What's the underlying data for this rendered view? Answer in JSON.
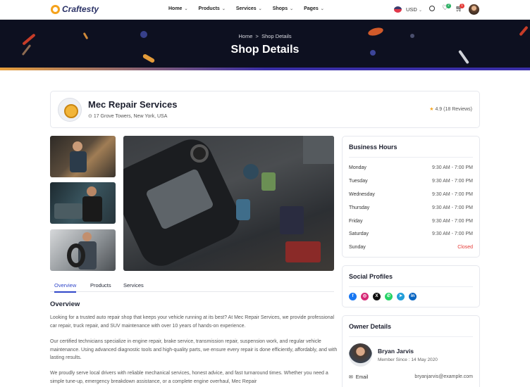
{
  "brand": {
    "name": "Craftesty"
  },
  "nav": {
    "menu": [
      {
        "label": "Home"
      },
      {
        "label": "Products"
      },
      {
        "label": "Services"
      },
      {
        "label": "Shops"
      },
      {
        "label": "Pages"
      }
    ],
    "currency": "USD",
    "wishlist_count": "2",
    "cart_count": "1"
  },
  "banner": {
    "breadcrumb_home": "Home",
    "breadcrumb_sep": ">",
    "breadcrumb_current": "Shop Details",
    "title": "Shop Details"
  },
  "shop": {
    "name": "Mec Repair Services",
    "address": "17 Grove Towers, New York, USA",
    "rating": "4.9",
    "reviews": "(18 Reviews)"
  },
  "tabs": [
    {
      "label": "Overview",
      "active": true
    },
    {
      "label": "Products"
    },
    {
      "label": "Services"
    }
  ],
  "overview": {
    "heading": "Overview",
    "p1": "Looking for a trusted auto repair shop that keeps your vehicle running at its best? At Mec Repair Services, we provide professional car repair, truck repair, and SUV maintenance with over 10 years of hands-on experience.",
    "p2": "Our certified technicians specialize in engine repair, brake service, transmission repair, suspension work, and regular vehicle maintenance. Using advanced diagnostic tools and high-quality parts, we ensure every repair is done efficiently, affordably, and with lasting results.",
    "p3": "We proudly serve local drivers with reliable mechanical services, honest advice, and fast turnaround times. Whether you need a simple tune-up, emergency breakdown assistance, or a complete engine overhaul, Mec Repair"
  },
  "hours": {
    "title": "Business Hours",
    "rows": [
      {
        "day": "Monday",
        "time": "9:30 AM - 7:00 PM"
      },
      {
        "day": "Tuesday",
        "time": "9:30 AM - 7:00 PM"
      },
      {
        "day": "Wednesday",
        "time": "9:30 AM - 7:00 PM"
      },
      {
        "day": "Thursday",
        "time": "9:30 AM - 7:00 PM"
      },
      {
        "day": "Friday",
        "time": "9:30 AM - 7:00 PM"
      },
      {
        "day": "Saturday",
        "time": "9:30 AM - 7:00 PM"
      },
      {
        "day": "Sunday",
        "time": "Closed"
      }
    ]
  },
  "social": {
    "title": "Social Profiles",
    "items": [
      {
        "icon": "facebook-icon",
        "glyph": "f",
        "color": "#1877f2"
      },
      {
        "icon": "instagram-icon",
        "glyph": "◎",
        "color": "#d62976"
      },
      {
        "icon": "x-icon",
        "glyph": "X",
        "color": "#111111"
      },
      {
        "icon": "whatsapp-icon",
        "glyph": "✆",
        "color": "#25d366"
      },
      {
        "icon": "telegram-icon",
        "glyph": "➤",
        "color": "#229ed9"
      },
      {
        "icon": "linkedin-icon",
        "glyph": "in",
        "color": "#0a66c2"
      }
    ]
  },
  "owner": {
    "title": "Owner Details",
    "name": "Bryan Jarvis",
    "member_since": "Member Since : 14 May 2020",
    "email_label": "Email",
    "email": "bryanjarvis@example.com"
  },
  "colors": {
    "accent": "#3046c9",
    "star": "#f5a623",
    "closed": "#e53935",
    "banner_bg": "#0d1020"
  }
}
